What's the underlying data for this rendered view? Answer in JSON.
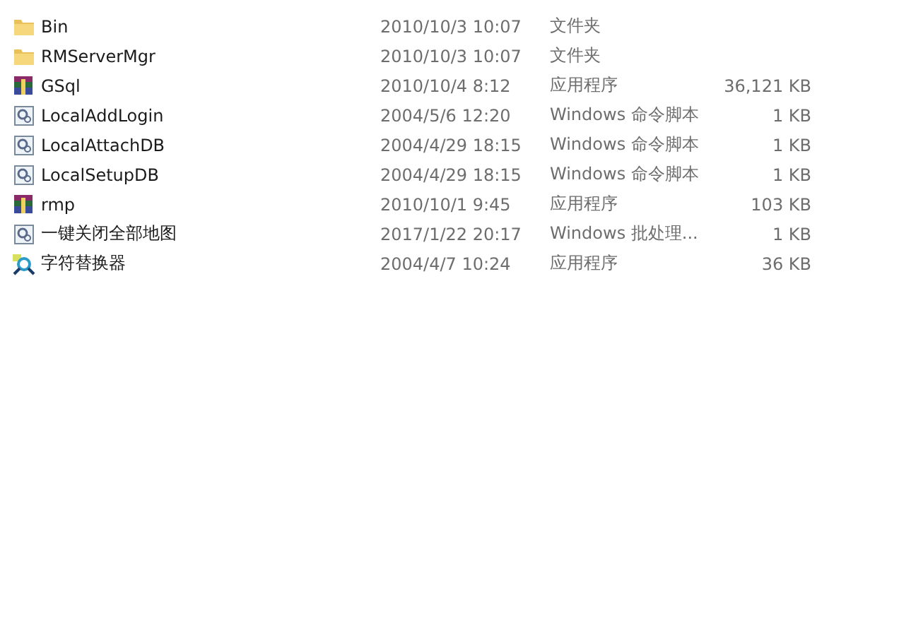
{
  "files": [
    {
      "kind": "folder",
      "name": "Bin",
      "date": "2010/10/3 10:07",
      "type": "文件夹"
    },
    {
      "kind": "folder",
      "name": "RMServerMgr",
      "date": "2010/10/3 10:07",
      "type": "文件夹"
    },
    {
      "kind": "archive",
      "name": "GSql",
      "date": "2010/10/4 8:12",
      "type": "应用程序",
      "size": "36,121 KB"
    },
    {
      "kind": "script",
      "name": "LocalAddLogin",
      "date": "2004/5/6 12:20",
      "type": "Windows 命令脚本",
      "size": "1 KB"
    },
    {
      "kind": "script",
      "name": "LocalAttachDB",
      "date": "2004/4/29 18:15",
      "type": "Windows 命令脚本",
      "size": "1 KB"
    },
    {
      "kind": "script",
      "name": "LocalSetupDB",
      "date": "2004/4/29 18:15",
      "type": "Windows 命令脚本",
      "size": "1 KB"
    },
    {
      "kind": "archive",
      "name": "rmp",
      "date": "2010/10/1 9:45",
      "type": "应用程序",
      "size": "103 KB"
    },
    {
      "kind": "script",
      "name": "一键关闭全部地图",
      "date": "2017/1/22 20:17",
      "type": "Windows 批处理...",
      "size": "1 KB"
    },
    {
      "kind": "tool",
      "name": "字符替换器",
      "date": "2004/4/7 10:24",
      "type": "应用程序",
      "size": "36 KB"
    }
  ]
}
